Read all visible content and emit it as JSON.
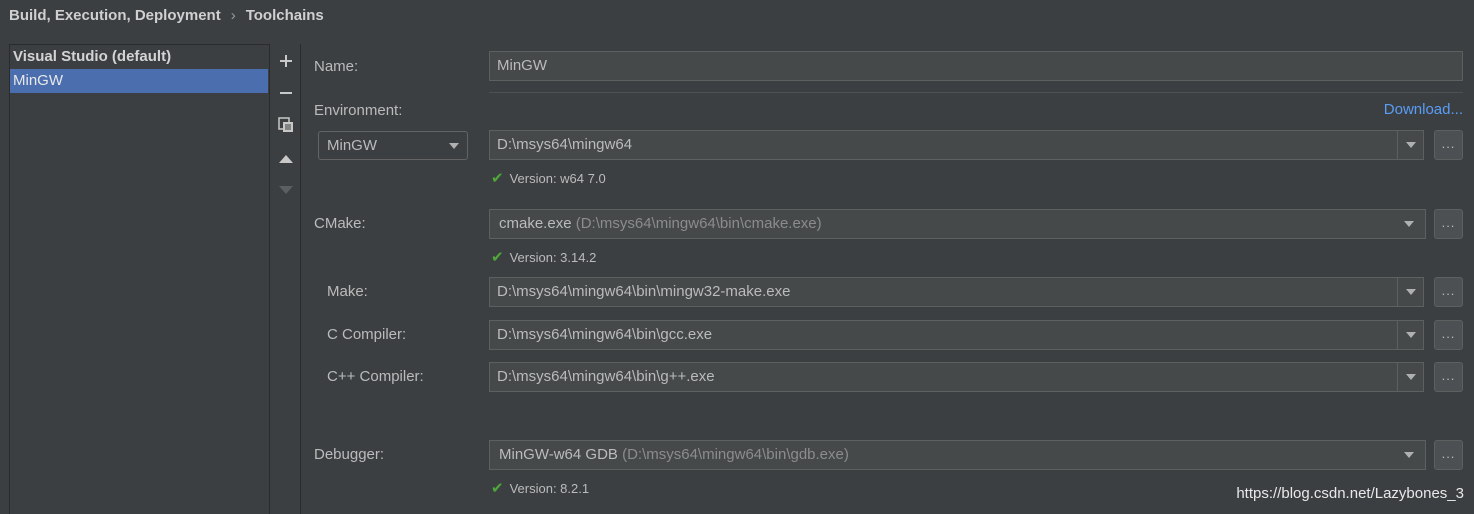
{
  "breadcrumb": {
    "parent": "Build, Execution, Deployment",
    "separator": "›",
    "current": "Toolchains"
  },
  "toolchains": [
    {
      "label": "Visual Studio (default)"
    },
    {
      "label": "MinGW"
    }
  ],
  "toolbar": {
    "add": "+",
    "remove": "−"
  },
  "form": {
    "name_label": "Name:",
    "name_value": "MinGW",
    "environment_label": "Environment:",
    "download_link": "Download...",
    "env_type": "MinGW",
    "env_path": "D:\\msys64\\mingw64",
    "env_version": "Version: w64 7.0",
    "cmake_label": "CMake:",
    "cmake_value": "cmake.exe",
    "cmake_path": "(D:\\msys64\\mingw64\\bin\\cmake.exe)",
    "cmake_version": "Version: 3.14.2",
    "make_label": "Make:",
    "make_value": "D:\\msys64\\mingw64\\bin\\mingw32-make.exe",
    "c_label": "C Compiler:",
    "c_value": "D:\\msys64\\mingw64\\bin\\gcc.exe",
    "cpp_label": "C++ Compiler:",
    "cpp_value": "D:\\msys64\\mingw64\\bin\\g++.exe",
    "debugger_label": "Debugger:",
    "debugger_value": "MinGW-w64 GDB",
    "debugger_path": "(D:\\msys64\\mingw64\\bin\\gdb.exe)",
    "debugger_version": "Version: 8.2.1",
    "browse_label": "..."
  },
  "watermark": "https://blog.csdn.net/Lazybones_3",
  "colors": {
    "accent": "#4b6eaf",
    "link": "#589df6",
    "ok": "#4fa83a",
    "background": "#3c3f41"
  }
}
